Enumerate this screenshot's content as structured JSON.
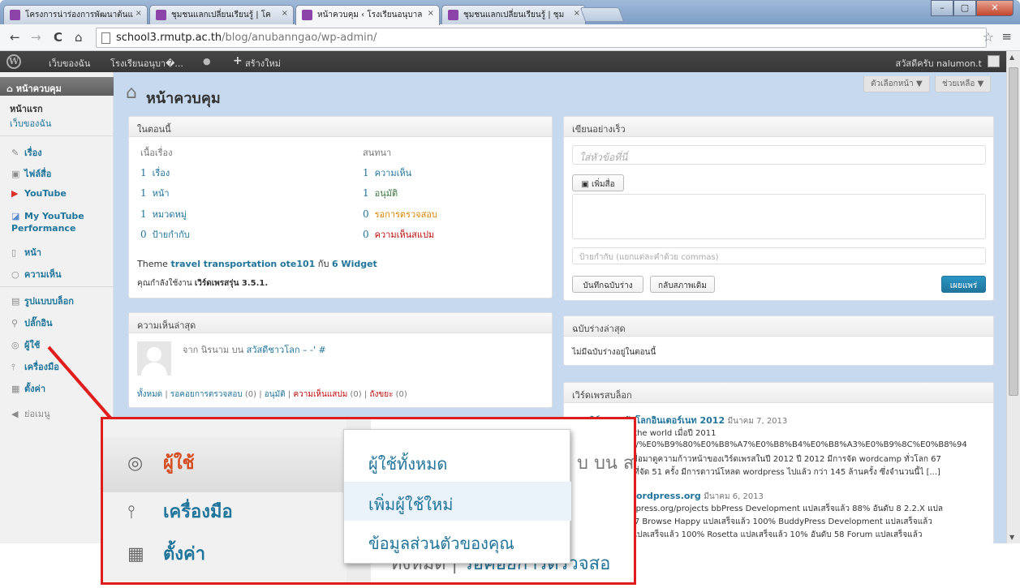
{
  "browser": {
    "tabs": [
      {
        "title": "โครงการน่าร่องการพัฒนาต้นแ",
        "close": "×"
      },
      {
        "title": "ชุมชนแลกเปลี่ยนเรียนรู้ | โค",
        "close": "×"
      },
      {
        "title": "หน้าควบคุม ‹ โรงเรียนอนุบาล",
        "close": "×"
      },
      {
        "title": "ชุมชนแลกเปลี่ยนเรียนรู้ | ชุม",
        "close": "×"
      }
    ],
    "window_buttons": {
      "minimize": "–",
      "maximize": "▢",
      "close": "✕"
    },
    "nav": {
      "back": "←",
      "forward": "→",
      "reload": "C",
      "home": "⌂"
    },
    "url_host": "school3.rmutp.ac.th",
    "url_path": "/blog/anubanngao/wp-admin/",
    "star": "☆",
    "menu": "≡"
  },
  "adminbar": {
    "wp": "W",
    "my_sites": "เว็บของฉัน",
    "site_name": "โรงเรียนอนุบา�...",
    "comments_icon": "●",
    "new_plus": "+",
    "new_label": "สร้างใหม่",
    "howdy": "สวัสดีครับ nalumon.t"
  },
  "sidebar": {
    "dashboard": "หน้าควบคุม",
    "home": "หน้าแรก",
    "my_sites": "เว็บของฉัน",
    "items": [
      {
        "icon": "✎",
        "label": "เรื่อง"
      },
      {
        "icon": "▣",
        "label": "ไฟล์สื่อ"
      },
      {
        "icon": "▶",
        "label": "YouTube"
      },
      {
        "icon": "◪",
        "label": "My YouTube Performance"
      },
      {
        "icon": "▯",
        "label": "หน้า"
      },
      {
        "icon": "○",
        "label": "ความเห็น"
      },
      {
        "icon": "▤",
        "label": "รูปแบบบล็อก"
      },
      {
        "icon": "⚲",
        "label": "ปลั๊กอิน"
      },
      {
        "icon": "◎",
        "label": "ผู้ใช้"
      },
      {
        "icon": "⫯",
        "label": "เครื่องมือ"
      },
      {
        "icon": "▦",
        "label": "ตั้งค่า"
      }
    ],
    "collapse": "ย่อเมนู",
    "collapse_icon": "◀"
  },
  "main": {
    "title": "หน้าควบคุม",
    "screen_options": "ตัวเลือกหน้า ▼",
    "help": "ช่วยเหลือ ▼"
  },
  "right_now": {
    "title": "ในตอนนี้",
    "content_header": "เนื้อเรื่อง",
    "discussion_header": "สนทนา",
    "content": [
      {
        "num": "1",
        "label": "เรื่อง"
      },
      {
        "num": "1",
        "label": "หน้า"
      },
      {
        "num": "1",
        "label": "หมวดหมู่"
      },
      {
        "num": "0",
        "label": "ป้ายกำกับ"
      }
    ],
    "discussion": [
      {
        "num": "1",
        "label": "ความเห็น"
      },
      {
        "num": "1",
        "label": "อนุมัติ"
      },
      {
        "num": "0",
        "label": "รอการตรวจสอบ"
      },
      {
        "num": "0",
        "label": "ความเห็นสแปม"
      }
    ],
    "theme_prefix": "Theme",
    "theme_name": "travel transportation ote101",
    "theme_mid": "กับ",
    "widgets": "6 Widget",
    "version_prefix": "คุณกำลังใช้งาน",
    "version": "เวิร์ดเพรสรุ่น 3.5.1."
  },
  "recent_comments": {
    "title": "ความเห็นล่าสุด",
    "from": "จาก นิรนาม บน",
    "post": "สวัสดีชาวโลก – -' #",
    "filters": {
      "all": "ทั้งหมด",
      "pending": "รอคอยการตรวจสอบ",
      "pending_count": "(0)",
      "approved": "อนุมัติ",
      "spam": "ความเห็นแสปม",
      "spam_count": "(0)",
      "trash": "ถังขยะ",
      "trash_count": "(0)",
      "sep": "|"
    }
  },
  "quick_press": {
    "title": "เขียนอย่างเร็ว",
    "title_placeholder": "ใส่หัวข้อที่นี่",
    "add_media": "เพิ่มสื่อ",
    "tags_placeholder": "ป้ายกำกับ (แยกแต่ละคำด้วย commas)",
    "save_draft": "บันทึกฉบับร่าง",
    "reset": "กลับสภาพเดิม",
    "publish": "เผยแพร่"
  },
  "recent_drafts": {
    "title": "ฉบับร่างล่าสุด",
    "empty": "ไม่มีฉบับร่างอยู่ในตอนนี้"
  },
  "wp_blog": {
    "title": "เวิร์ดเพรสบล็อก",
    "items": [
      {
        "title": "เวิร์ดเพรสกับโลกอินเตอร์เนท 2012",
        "date": "มีนาคม 7, 2013"
      },
      {
        "title": "สวัสดีครับ wordpress.org",
        "date": "มีนาคม 6, 2013"
      }
    ],
    "lines": [
      "e of the world เมื่อปี 2011",
      ".com/%E0%B9%80%E0%B8%A7%E0%B8%B4%E0%B8%A3%E0%B9%8C%E0%B8%94",
      "rd/  เมื่อมาดูความก้าวหน้าของเวิร์ดเพรสในปี 2012 ปี 2012 มีการจัด wordcamp ทั่วโลก 67",
      "011  ที่จัด 51 ครั้ง มีการดาวน์โหลด wordpress ไปแล้ว กว่า 145 ล้านครั้ง  ซึ่งจำนวนนี้ไ [...]",
      "wordpress.org/projects bbPress Development   แปลเสร็จแล้ว 88% อันดับ 8 2.2.X แปล",
      "นดับ 7 Browse Happy แปลเสร็จแล้ว 100% BuddyPress Development   แปลเสร็จแล้ว",
      "5.X แปลเสร็จแล้ว 100% Rosetta แปลเสร็จแล้ว 10% อันดับ 58 Forum แปลเสร็จแล้ว"
    ]
  },
  "callout": {
    "users": "ผู้ใช้",
    "tools": "เครื่องมือ",
    "settings": "ตั้งค่า",
    "flyout": [
      "ผู้ใช้ทั้งหมด",
      "เพิ่มผู้ใช้ใหม่",
      "ข้อมูลส่วนตัวของคุณ"
    ],
    "bg_text_top": "บ บน ส",
    "bg_all": "ทั้งหมด",
    "bg_sep": "|",
    "bg_pending": "รอคอยการตรวจสอ",
    "color": "#e01d1d"
  }
}
